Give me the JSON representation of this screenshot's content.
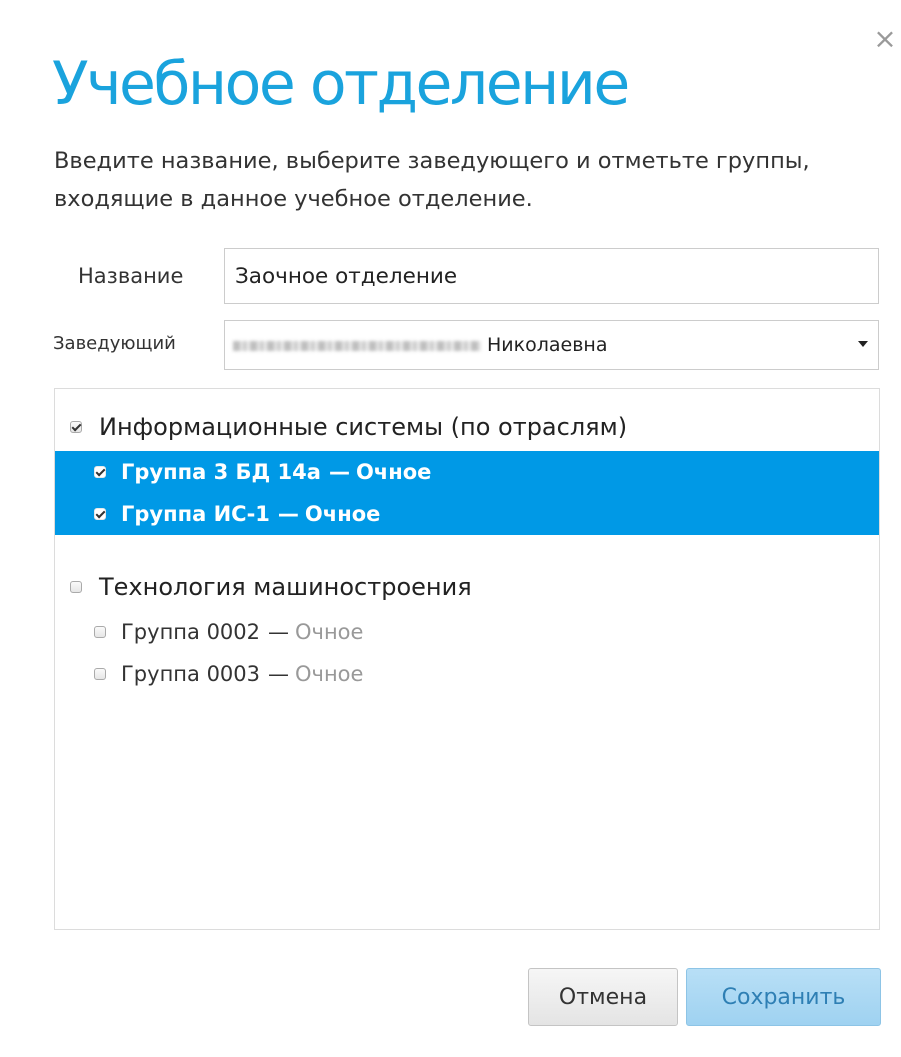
{
  "dialog": {
    "close_glyph": "×",
    "title": "Учебное отделение",
    "instructions": "Введите название, выберите заведующего и отметьте группы, входящие в данное учебное отделение."
  },
  "form": {
    "name_label": "Название",
    "name_value": "Заочное отделение",
    "head_label": "Заведующий",
    "head_value_visible": "Николаевна"
  },
  "departments": [
    {
      "label": "Информационные системы (по отраслям)",
      "checked": true,
      "groups": [
        {
          "name": "Группа 3 БД 14а",
          "separator": "—",
          "type": "Очное",
          "checked": true,
          "selected": true
        },
        {
          "name": "Группа ИС-1",
          "separator": "—",
          "type": "Очное",
          "checked": true,
          "selected": true
        }
      ]
    },
    {
      "label": "Технология машиностроения",
      "checked": false,
      "groups": [
        {
          "name": "Группа 0002",
          "separator": "—",
          "type": "Очное",
          "checked": false,
          "selected": false
        },
        {
          "name": "Группа 0003",
          "separator": "—",
          "type": "Очное",
          "checked": false,
          "selected": false
        }
      ]
    }
  ],
  "buttons": {
    "cancel": "Отмена",
    "save": "Сохранить"
  },
  "colors": {
    "title": "#1aa3dd",
    "selection": "#0099e6",
    "save_button": "#a9d8f3"
  },
  "icons": {
    "close": "close-icon",
    "dropdown": "caret-down-icon",
    "checkbox": "checkbox-icon"
  }
}
